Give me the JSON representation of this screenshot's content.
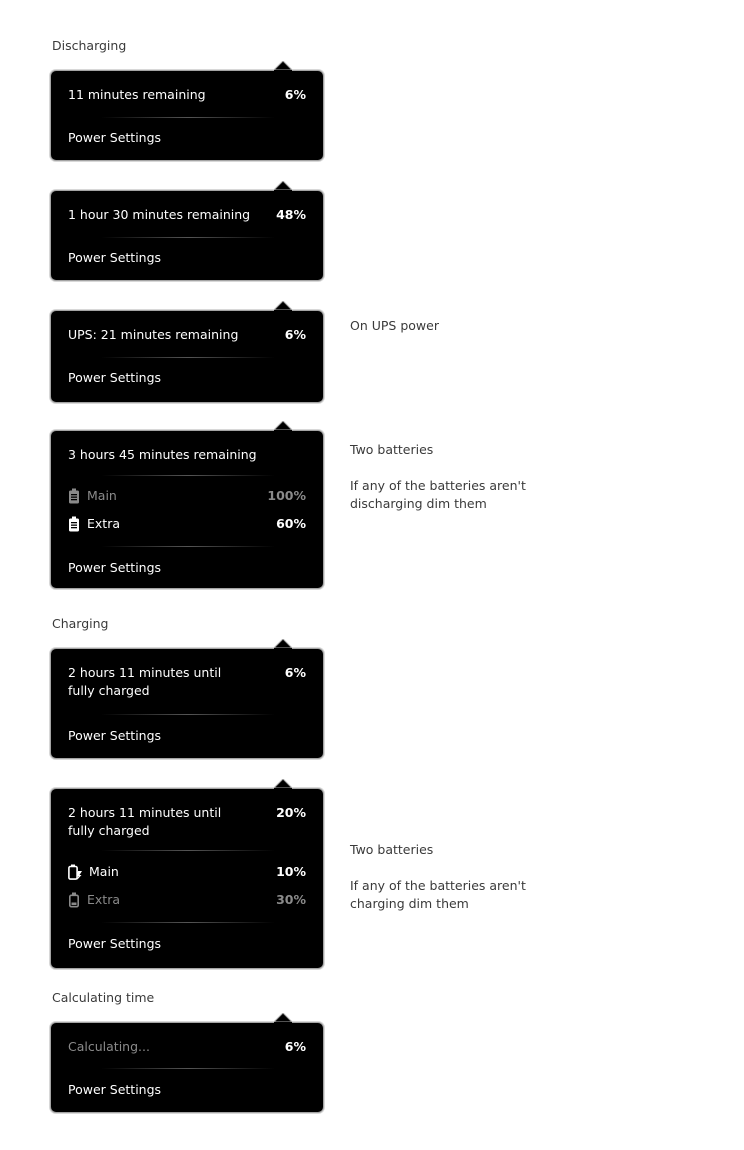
{
  "sections": {
    "discharging": "Discharging",
    "charging": "Charging",
    "calculating": "Calculating time"
  },
  "popups": [
    {
      "status": "11 minutes remaining",
      "percent": "6%",
      "settings": "Power Settings"
    },
    {
      "status": "1 hour 30 minutes remaining",
      "percent": "48%",
      "settings": "Power Settings"
    },
    {
      "status": "UPS: 21 minutes remaining",
      "percent": "6%",
      "settings": "Power Settings",
      "note": "On UPS power"
    },
    {
      "status": "3 hours 45 minutes remaining",
      "settings": "Power Settings",
      "batteries": [
        {
          "name": "Main",
          "percent": "100%",
          "dim": true,
          "icon": "battery-full-icon"
        },
        {
          "name": "Extra",
          "percent": "60%",
          "dim": false,
          "icon": "battery-full-icon"
        }
      ],
      "note_title": "Two batteries",
      "note_body": "If any of the batteries aren't discharging dim them"
    },
    {
      "status": "2 hours 11 minutes until fully charged",
      "percent": "6%",
      "settings": "Power Settings"
    },
    {
      "status": "2 hours 11 minutes until fully charged",
      "percent": "20%",
      "settings": "Power Settings",
      "batteries": [
        {
          "name": "Main",
          "percent": "10%",
          "dim": false,
          "icon": "battery-charging-icon"
        },
        {
          "name": "Extra",
          "percent": "30%",
          "dim": true,
          "icon": "battery-empty-icon"
        }
      ],
      "note_title": "Two batteries",
      "note_body": "If any of the batteries aren't charging dim them"
    },
    {
      "status": "Calculating...",
      "percent": "6%",
      "settings": "Power Settings"
    }
  ],
  "colors": {
    "popup_bg": "#000000",
    "dim_text": "#8a8a8a",
    "border": "#a4a4a4"
  }
}
